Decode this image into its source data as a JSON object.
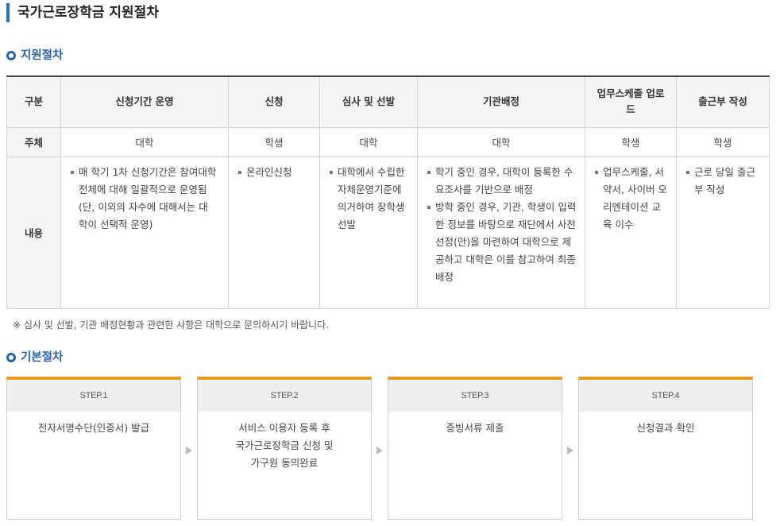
{
  "page": {
    "title": "국가근로장학금 지원절차"
  },
  "section_support": {
    "title": "지원절차"
  },
  "table": {
    "headers": [
      "구분",
      "신청기간 운영",
      "신청",
      "심사 및 선발",
      "기관배정",
      "업무스케줄 업로드",
      "출근부 작성"
    ],
    "subject_row": {
      "label": "주체",
      "cells": [
        "대학",
        "학생",
        "대학",
        "대학",
        "학생",
        "학생"
      ]
    },
    "content_row": {
      "label": "내용",
      "cells": [
        [
          "매 학기 1차 신청기간은 참여대학 전체에 대해 일괄적으로 운영됨(단, 이외의 자수에 대해서는 대학이 선택적 운영)"
        ],
        [
          "온라인신청"
        ],
        [
          "대학에서 수립한 자체운영기준에 의거하여 장학생 선발"
        ],
        [
          "학기 중인 경우, 대학이 등록한 수요조사를 기반으로 배정",
          "방학 중인 경우, 기관, 학생이 입력한 정보를 바탕으로 재단에서 사전 선정(안)을 마련하여 대학으로 제공하고 대학은 이를 참고하여 최종 배정"
        ],
        [
          "업무스케줄, 서약서, 사이버 오리엔테이션 교육 이수"
        ],
        [
          "근로 당일 출근부 작성"
        ]
      ]
    }
  },
  "note": "※ 심사 및 선발, 기관 배정현황과 관련한 사항은 대학으로 문의하시기 바랍니다.",
  "section_basic": {
    "title": "기본절차"
  },
  "steps": [
    {
      "label": "STEP.1",
      "text": "전자서명수단(인증서) 발급"
    },
    {
      "label": "STEP.2",
      "text": "서비스 이용자 등록 후\n국가근로장학금 신청 및\n가구원 동의완료"
    },
    {
      "label": "STEP.3",
      "text": "증빙서류 제출"
    },
    {
      "label": "STEP.4",
      "text": "신청결과 확인"
    }
  ],
  "colors": {
    "accent_blue": "#2a62a8",
    "step_orange": "#e39a1f",
    "header_bg": "#f4f4f6"
  },
  "icons": {
    "section_marker": "ring-bullet-icon",
    "step_arrow": "triangle-right-icon"
  }
}
